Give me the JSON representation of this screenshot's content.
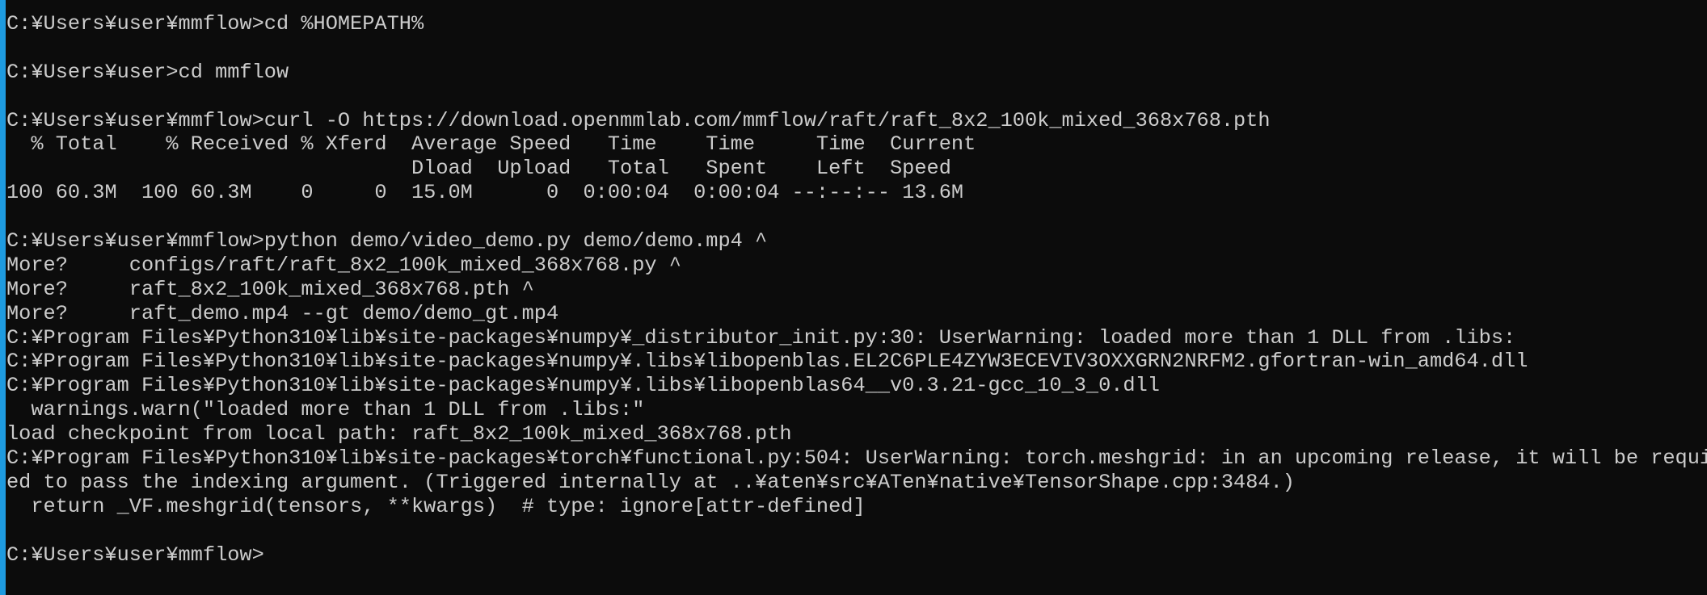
{
  "window": {
    "accent_color": "#1e9be0",
    "background": "#0c0c0c",
    "text_color": "#cccccc"
  },
  "console": {
    "lines": [
      "C:¥Users¥user¥mmflow>cd %HOMEPATH%",
      "",
      "C:¥Users¥user>cd mmflow",
      "",
      "C:¥Users¥user¥mmflow>curl -O https://download.openmmlab.com/mmflow/raft/raft_8x2_100k_mixed_368x768.pth",
      "  % Total    % Received % Xferd  Average Speed   Time    Time     Time  Current",
      "                                 Dload  Upload   Total   Spent    Left  Speed",
      "100 60.3M  100 60.3M    0     0  15.0M      0  0:00:04  0:00:04 --:--:-- 13.6M",
      "",
      "C:¥Users¥user¥mmflow>python demo/video_demo.py demo/demo.mp4 ^",
      "More?     configs/raft/raft_8x2_100k_mixed_368x768.py ^",
      "More?     raft_8x2_100k_mixed_368x768.pth ^",
      "More?     raft_demo.mp4 --gt demo/demo_gt.mp4",
      "C:¥Program Files¥Python310¥lib¥site-packages¥numpy¥_distributor_init.py:30: UserWarning: loaded more than 1 DLL from .libs:",
      "C:¥Program Files¥Python310¥lib¥site-packages¥numpy¥.libs¥libopenblas.EL2C6PLE4ZYW3ECEVIV3OXXGRN2NRFM2.gfortran-win_amd64.dll",
      "C:¥Program Files¥Python310¥lib¥site-packages¥numpy¥.libs¥libopenblas64__v0.3.21-gcc_10_3_0.dll",
      "  warnings.warn(\"loaded more than 1 DLL from .libs:\"",
      "load checkpoint from local path: raft_8x2_100k_mixed_368x768.pth",
      "C:¥Program Files¥Python310¥lib¥site-packages¥torch¥functional.py:504: UserWarning: torch.meshgrid: in an upcoming release, it will be requir",
      "ed to pass the indexing argument. (Triggered internally at ..¥aten¥src¥ATen¥native¥TensorShape.cpp:3484.)",
      "  return _VF.meshgrid(tensors, **kwargs)  # type: ignore[attr-defined]",
      "",
      "C:¥Users¥user¥mmflow>"
    ]
  }
}
